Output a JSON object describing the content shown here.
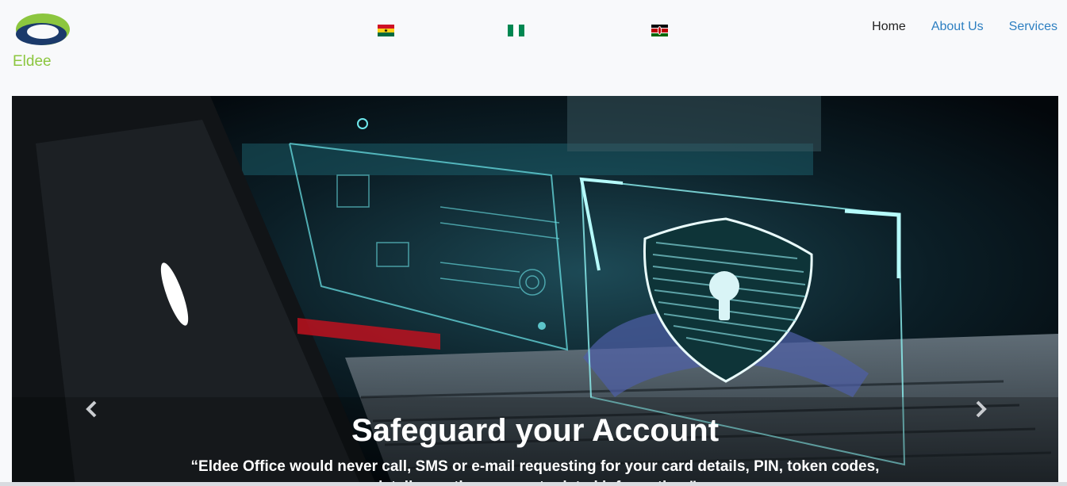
{
  "brand": {
    "name": "Eldee",
    "logo_icon": "eldee-swoosh-logo"
  },
  "flags": [
    {
      "name": "ghana-flag-icon",
      "colors": [
        "#ce1126",
        "#fcd116",
        "#006b3f"
      ]
    },
    {
      "name": "nigeria-flag-icon",
      "colors": [
        "#008751",
        "#ffffff",
        "#008751"
      ]
    },
    {
      "name": "kenya-flag-icon",
      "colors": [
        "#000000",
        "#bb0000",
        "#006600"
      ]
    }
  ],
  "nav": {
    "home": "Home",
    "about": "About Us",
    "services": "Services"
  },
  "carousel": {
    "prev_icon": "chevron-left-icon",
    "next_icon": "chevron-right-icon",
    "slide": {
      "title": "Safeguard your Account",
      "text": "“Eldee Office would never call, SMS or e-mail requesting for your card details, PIN, token codes, details or other account related information.”"
    }
  },
  "colors": {
    "accent": "#2d7fc1",
    "brand_green": "#8cc63f",
    "brand_navy": "#1b3a6b"
  }
}
